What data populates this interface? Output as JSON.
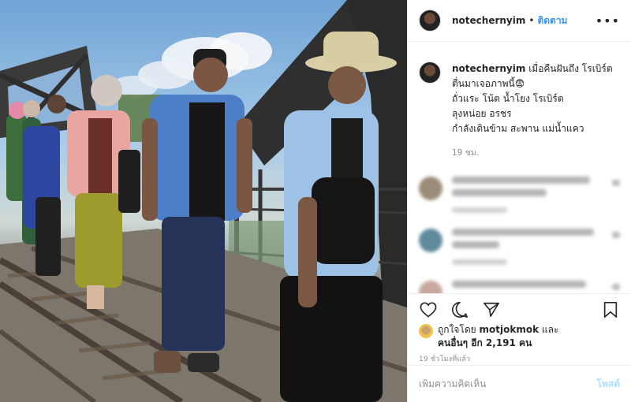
{
  "post": {
    "username": "notechernyim",
    "follow_label": "ติดตาม",
    "dot": "•",
    "more_glyph": "•••"
  },
  "caption": {
    "username": "notechernyim",
    "lines": [
      "เมื่อคืนฝันถึง โรเบิร์ต",
      "ตื่นมาเจอภาพนี้😨",
      "ถั่วแระ โน้ต น้ำโยง โรเบิร์ต",
      "ลุงหน่อย อรชร",
      "กำลังเดินข้าม สะพาน แม่น้ำแคว"
    ],
    "time": "19 ชม."
  },
  "likes": {
    "prefix": "ถูกใจโดย",
    "liker": "motjokmok",
    "and": "และ",
    "others": "คนอื่นๆ อีก 2,191 คน"
  },
  "post_time": "19 ชั่วโมงที่แล้ว",
  "add_comment": {
    "placeholder": "เพิ่มความคิดเห็น",
    "post_label": "โพสต์"
  },
  "colors": {
    "accent": "#3897f0",
    "post_disabled": "#b2dffc",
    "muted": "#8e8e8e"
  },
  "icons": [
    "heart-icon",
    "comment-icon",
    "share-icon",
    "bookmark-icon"
  ]
}
